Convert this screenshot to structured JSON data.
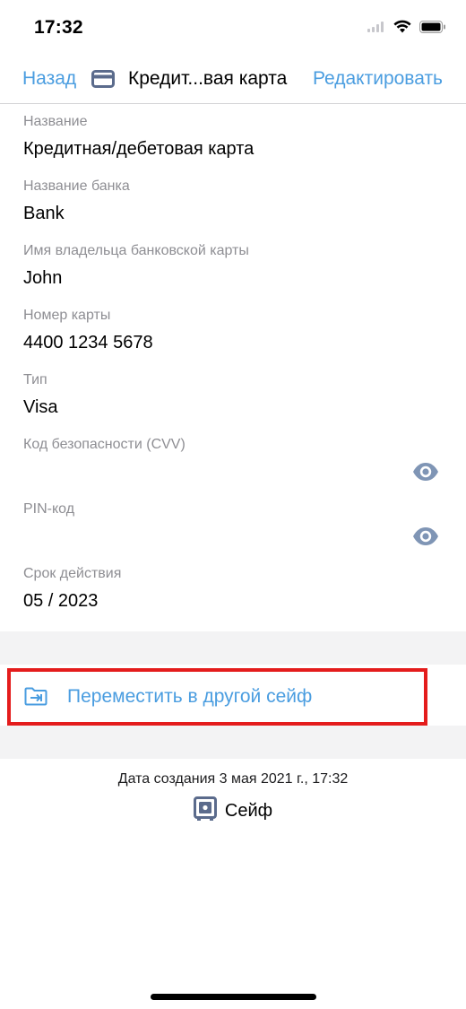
{
  "status_bar": {
    "time": "17:32"
  },
  "nav": {
    "back_label": "Назад",
    "title": "Кредит...вая карта",
    "edit_label": "Редактировать"
  },
  "fields": [
    {
      "label": "Название",
      "value": "Кредитная/дебетовая карта"
    },
    {
      "label": "Название банка",
      "value": "Bank"
    },
    {
      "label": "Имя владельца банковской карты",
      "value": "John"
    },
    {
      "label": "Номер карты",
      "value": "4400 1234 5678"
    },
    {
      "label": "Тип",
      "value": "Visa"
    },
    {
      "label": "Код безопасности (CVV)",
      "value": ""
    },
    {
      "label": "PIN-код",
      "value": ""
    },
    {
      "label": "Срок действия",
      "value": "05 / 2023"
    }
  ],
  "move_action": {
    "label": "Переместить в другой сейф"
  },
  "footer": {
    "created": "Дата создания 3 мая 2021 г., 17:32",
    "vault_label": "Сейф"
  },
  "colors": {
    "accent": "#4a9de0",
    "icon": "#5b6b8c",
    "highlight": "#e41c1c"
  }
}
